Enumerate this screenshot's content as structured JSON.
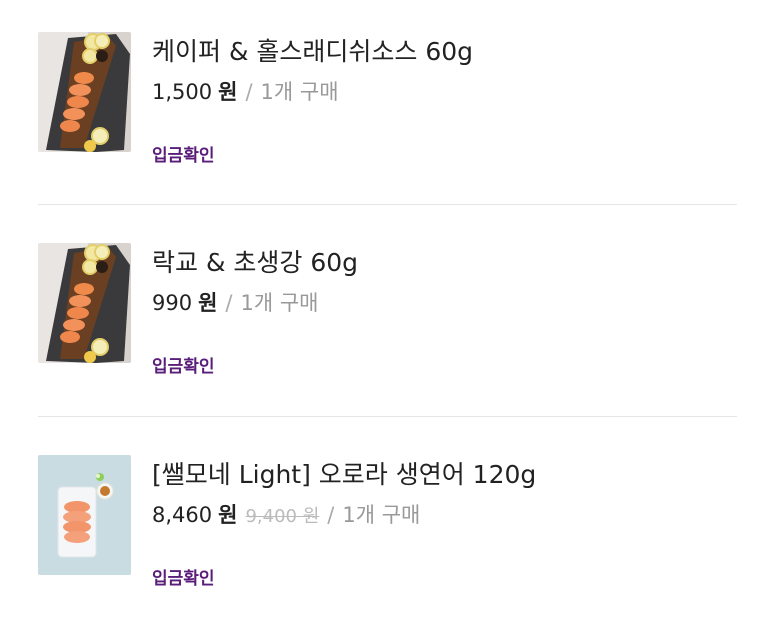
{
  "colors": {
    "status": "#5a1e7a",
    "text": "#222222",
    "muted": "#999999",
    "divider": "#e6e6e6"
  },
  "orders": [
    {
      "image": "salmon-board-photo",
      "name": "케이퍼 & 홀스래디쉬소스 60g",
      "price": "1,500",
      "unit": "원",
      "original_price": "",
      "separator": "/",
      "quantity": "1개 구매",
      "status": "입금확인"
    },
    {
      "image": "salmon-board-photo",
      "name": "락교 & 초생강 60g",
      "price": "990",
      "unit": "원",
      "original_price": "",
      "separator": "/",
      "quantity": "1개 구매",
      "status": "입금확인"
    },
    {
      "image": "salmon-plate-photo",
      "name": "[쌜모네 Light] 오로라 생연어 120g",
      "price": "8,460",
      "unit": "원",
      "original_price": "9,400 원",
      "separator": "/",
      "quantity": "1개 구매",
      "status": "입금확인"
    }
  ]
}
